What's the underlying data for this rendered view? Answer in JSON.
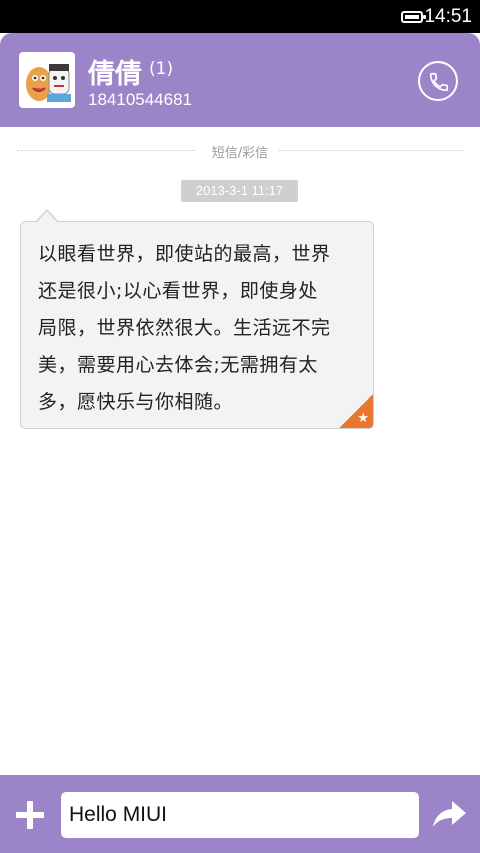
{
  "status_bar": {
    "time": "14:51",
    "battery_icon": "battery-full-icon"
  },
  "header": {
    "contact_name": "倩倩",
    "unread_count": "(1)",
    "phone_number": "18410544681",
    "avatar_icon": "avatar-icon",
    "call_icon": "phone-icon"
  },
  "conversation": {
    "message_type_label": "短信/彩信",
    "messages": [
      {
        "timestamp": "2013-3-1 11:17",
        "text": "以眼看世界，即使站的最高，世界\n还是很小;以心看世界，即使身处\n局限，世界依然很大。生活远不完\n美，需要用心去体会;无需拥有太\n多，愿快乐与你相随。",
        "starred": true
      }
    ]
  },
  "composer": {
    "input_value": "Hello MIUI",
    "add_icon": "plus-icon",
    "send_icon": "send-arrow-icon"
  },
  "colors": {
    "accent": "#9b84c8",
    "star_corner": "#e8762d"
  }
}
